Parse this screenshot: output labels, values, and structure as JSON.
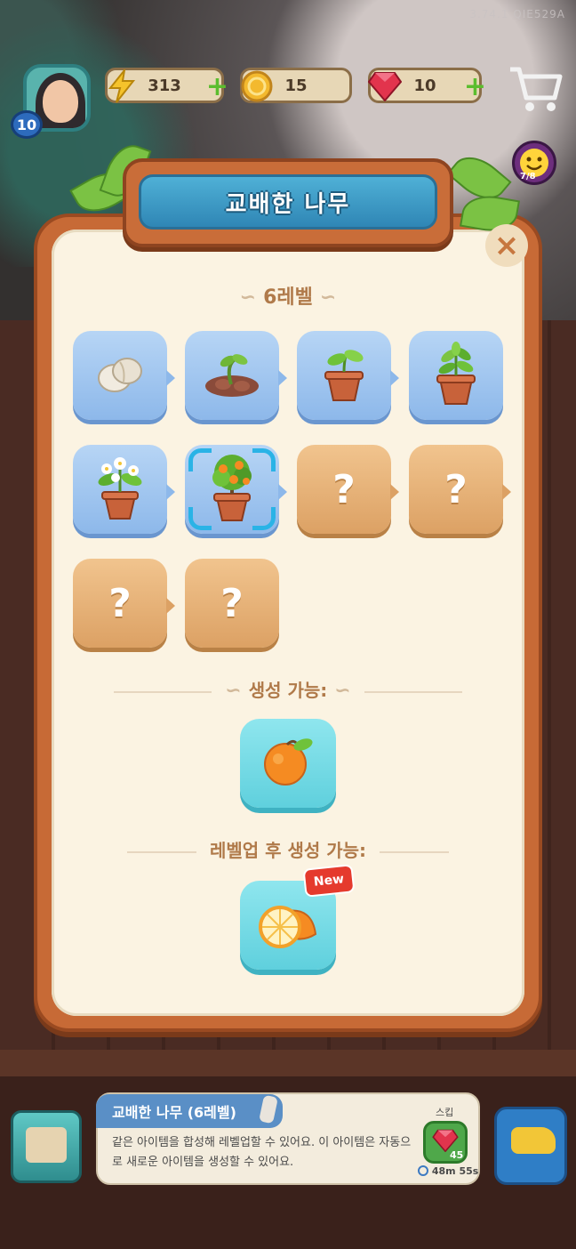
{
  "hud": {
    "version": "3.74.1 QIE529A",
    "player_level": "10",
    "energy": "313",
    "coins": "15",
    "gems": "10",
    "quest_progress": "7/8"
  },
  "dialog": {
    "title": "교배한 나무",
    "close_label": "×",
    "level_heading": "6레벨",
    "stages": [
      {
        "kind": "known",
        "icon": "walnut-seeds-icon"
      },
      {
        "kind": "known",
        "icon": "sprouting-soil-icon"
      },
      {
        "kind": "known",
        "icon": "seedling-pot-icon"
      },
      {
        "kind": "known",
        "icon": "leafy-plant-pot-icon"
      },
      {
        "kind": "known",
        "icon": "flowering-plant-pot-icon"
      },
      {
        "kind": "known",
        "icon": "orange-tree-pot-icon",
        "selected": true
      },
      {
        "kind": "unknown",
        "label": "?"
      },
      {
        "kind": "unknown",
        "label": "?"
      },
      {
        "kind": "unknown",
        "label": "?"
      },
      {
        "kind": "unknown",
        "label": "?"
      }
    ],
    "can_produce_heading": "생성 가능:",
    "can_produce_item": "orange-icon",
    "after_levelup_heading": "레벨업 후 생성 가능:",
    "after_levelup_item": "orange-slice-icon",
    "new_badge": "New"
  },
  "info_bar": {
    "tab_title": "교배한 나무 (6레벨)",
    "description": "같은 아이템을 합성해 레벨업할 수 있어요. 이 아이템은 자동으로 새로운 아이템을 생성할 수 있어요.",
    "skip_label": "스킵",
    "skip_cost": "45",
    "timer": "48m 55s"
  }
}
